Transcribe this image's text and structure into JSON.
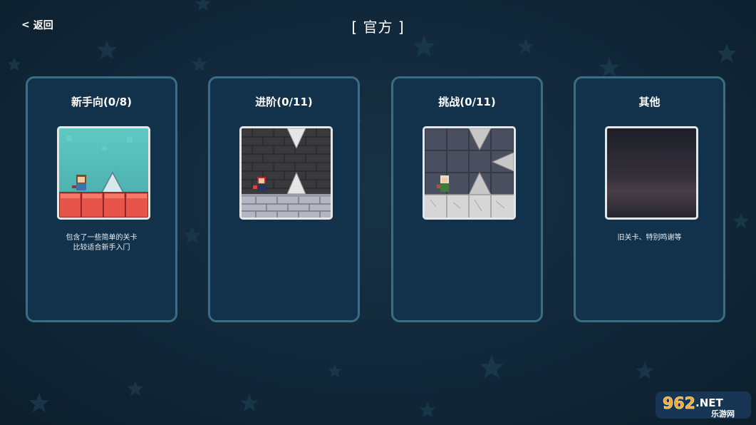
{
  "header": {
    "back_label": "返回",
    "title": "[ 官方 ]"
  },
  "categories": [
    {
      "title": "新手向(0/8)",
      "desc_lines": [
        "包含了一些简单的关卡",
        "比较适合新手入门"
      ]
    },
    {
      "title": "进阶(0/11)",
      "desc_lines": [
        "",
        ""
      ]
    },
    {
      "title": "挑战(0/11)",
      "desc_lines": [
        "",
        ""
      ]
    },
    {
      "title": "其他",
      "desc_lines": [
        "旧关卡、特别鸣谢等",
        ""
      ]
    }
  ],
  "watermark": {
    "logo_text": "962.NET",
    "sub_text": "乐游网"
  },
  "colors": {
    "background": "#11283a",
    "card_border": "#3d6d86",
    "card_fill": "#12314a",
    "text": "#ffffff"
  },
  "icons": {
    "back": "chevron-left-icon"
  }
}
